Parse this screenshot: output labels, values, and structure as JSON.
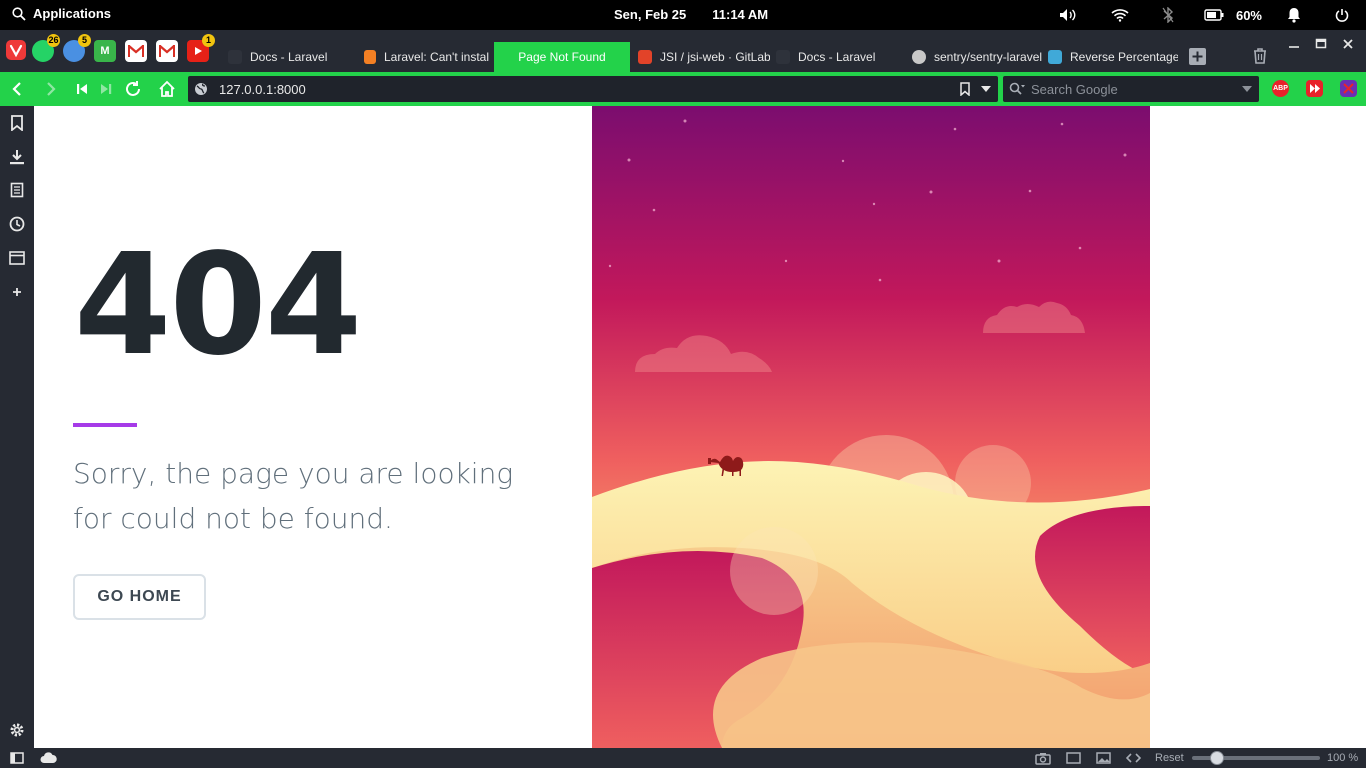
{
  "os_panel": {
    "applications_label": "Applications",
    "date": "Sen, Feb 25",
    "time": "11:14 AM",
    "battery": "60%"
  },
  "pinned": [
    {
      "icon": "whatsapp-icon",
      "badge": "26"
    },
    {
      "icon": "sync-icon",
      "badge": "5"
    },
    {
      "icon": "m-app-icon",
      "badge": ""
    },
    {
      "icon": "gmail-icon",
      "badge": ""
    },
    {
      "icon": "gmail-icon",
      "badge": ""
    },
    {
      "icon": "youtube-icon",
      "badge": "1"
    }
  ],
  "tabs": [
    {
      "title": "Docs - Laravel",
      "active": false
    },
    {
      "title": "Laravel: Can't instal",
      "active": false
    },
    {
      "title": "Page Not Found",
      "active": true
    },
    {
      "title": "JSI / jsi-web · GitLab",
      "active": false
    },
    {
      "title": "Docs - Laravel",
      "active": false
    },
    {
      "title": "sentry/sentry-laravel",
      "active": false
    },
    {
      "title": "Reverse Percentage",
      "active": false
    }
  ],
  "address": {
    "url": "127.0.0.1:8000",
    "search_placeholder": "Search Google"
  },
  "extensions": {
    "abp": "ABP"
  },
  "page": {
    "code": "404",
    "message": "Sorry, the page you are looking for could not be found.",
    "button": "GO HOME"
  },
  "status": {
    "reset_label": "Reset",
    "zoom": "100 %"
  },
  "colors": {
    "accent": "#23d24a",
    "chrome": "#262a33",
    "purple_line": "#a63ae8",
    "heading": "#22292f",
    "body_text": "#606f7b"
  }
}
